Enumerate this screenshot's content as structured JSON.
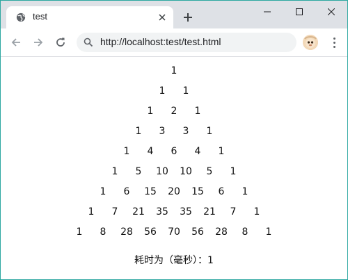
{
  "browser": {
    "tab_title": "test",
    "url": "http://localhost:test/test.html"
  },
  "icons": {
    "favicon": "globe-icon",
    "close": "close-icon",
    "new_tab": "plus-icon",
    "back": "arrow-left-icon",
    "forward": "arrow-right-icon",
    "reload": "reload-icon",
    "search": "search-icon",
    "profile": "avatar",
    "menu": "kebab-menu-icon",
    "minimize": "minimize-icon",
    "maximize": "maximize-icon",
    "window_close": "window-close-icon"
  },
  "pascal_rows": [
    [
      1
    ],
    [
      1,
      1
    ],
    [
      1,
      2,
      1
    ],
    [
      1,
      3,
      3,
      1
    ],
    [
      1,
      4,
      6,
      4,
      1
    ],
    [
      1,
      5,
      10,
      10,
      5,
      1
    ],
    [
      1,
      6,
      15,
      20,
      15,
      6,
      1
    ],
    [
      1,
      7,
      21,
      35,
      35,
      21,
      7,
      1
    ],
    [
      1,
      8,
      28,
      56,
      70,
      56,
      28,
      8,
      1
    ]
  ],
  "footer": {
    "elapsed_text": "耗时为（毫秒）：1"
  }
}
